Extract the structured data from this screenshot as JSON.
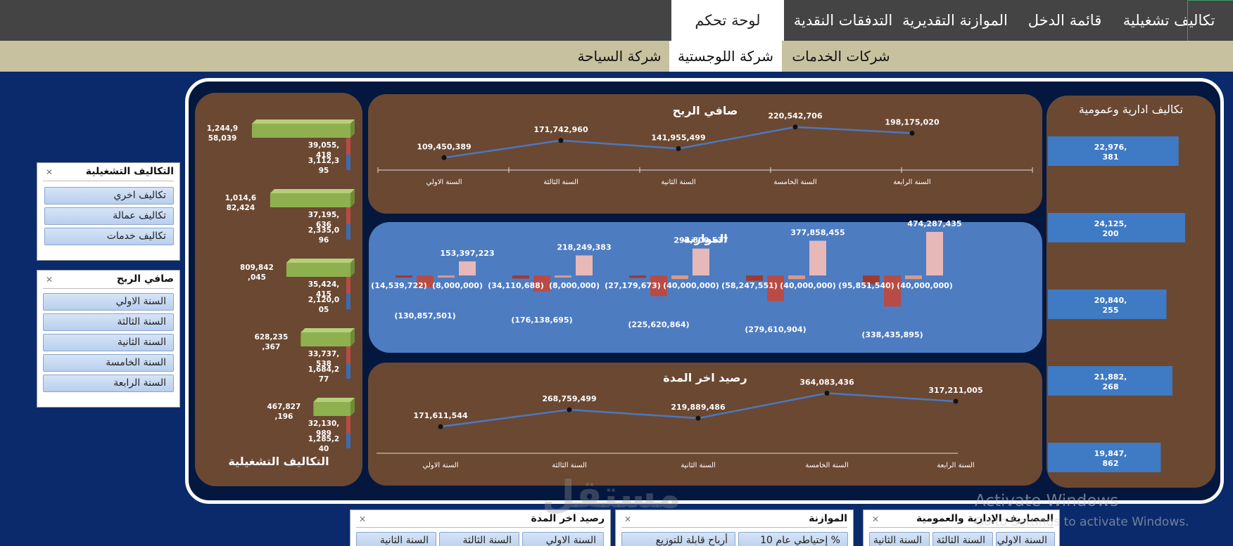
{
  "top_tabs": [
    {
      "label": "تكاليف تشغيلية"
    },
    {
      "label": "قائمة الدخل"
    },
    {
      "label": "الموازنة التقديرية"
    },
    {
      "label": "التدفقات النقدية"
    },
    {
      "label": "لوحة تحكم",
      "active": true
    }
  ],
  "sub_tabs": [
    {
      "label": "شركات الخدمات"
    },
    {
      "label": "شركة اللوجستية",
      "active": true
    },
    {
      "label": "شركة السياحة"
    }
  ],
  "slicers": {
    "operating_costs": {
      "title": "التكاليف التشغيلية",
      "items": [
        "تكاليف اخري",
        "تكاليف عمالة",
        "تكاليف خدمات"
      ]
    },
    "net_profit": {
      "title": "صافي الربح",
      "items": [
        "السنة الاولي",
        "السنة الثالثة",
        "السنة الثانية",
        "السنة الخامسة",
        "السنة الرابعة"
      ]
    },
    "end_balance": {
      "title": "رصيد اخر المدة",
      "items": [
        "السنة الاولي",
        "السنة الثالثة",
        "السنة الثانية"
      ]
    },
    "budget": {
      "title": "الموازنة",
      "items": [
        "إحتياطي عام 10 %",
        "أرباح قابلة للتوزيع"
      ]
    },
    "admin_expenses": {
      "title": "المصاريف الإدارية والعمومية",
      "items": [
        "السنة الاولي",
        "السنة الثالثة",
        "السنة الثانية"
      ]
    }
  },
  "watermark": {
    "line1": "Activate Windows",
    "line2": "Go to Settings to activate Windows.",
    "brand": "مستقل"
  },
  "chart_data": [
    {
      "id": "net_profit",
      "type": "line",
      "title": "صافي الربح",
      "categories": [
        "السنة الاولي",
        "السنة الثالثة",
        "السنة الثانية",
        "السنة الخامسة",
        "السنة الرابعة"
      ],
      "values": [
        109450389,
        171742960,
        141955499,
        220542706,
        198175020
      ],
      "labels": [
        "109,450,389",
        "171,742,960",
        "141,955,499",
        "220,542,706",
        "198,175,020"
      ],
      "color": "#4a78c0"
    },
    {
      "id": "budget",
      "type": "bar",
      "title": "الموازنة",
      "groups": [
        {
          "values": [
            -14539722,
            -130857501,
            -8000000,
            153397223
          ],
          "labels": [
            "(14,539,722)",
            "(130,857,501)",
            "(8,000,000)",
            "153,397,223"
          ]
        },
        {
          "values": [
            -34110688,
            -176138695,
            -8000000,
            218249383
          ],
          "labels": [
            "(34,110,688)",
            "(176,138,695)",
            "(8,000,000)",
            "218,249,383"
          ]
        },
        {
          "values": [
            -27179673,
            -225620864,
            -40000000,
            292800537
          ],
          "labels": [
            "(27,179,673)",
            "(225,620,864)",
            "(40,000,000)",
            "292,800,537"
          ]
        },
        {
          "values": [
            -58247551,
            -279610904,
            -40000000,
            377858455
          ],
          "labels": [
            "(58,247,551)",
            "(279,610,904)",
            "(40,000,000)",
            "377,858,455"
          ]
        },
        {
          "values": [
            -95851540,
            -338435895,
            -40000000,
            474287435
          ],
          "labels": [
            "(95,851,540)",
            "(338,435,895)",
            "(40,000,000)",
            "474,287,435"
          ]
        }
      ],
      "series_colors": [
        "#9e3a34",
        "#b84b45",
        "#d89a8a",
        "#e6b8b8"
      ]
    },
    {
      "id": "end_balance",
      "type": "line",
      "title": "رصيد اخر المدة",
      "categories": [
        "السنة الاولي",
        "السنة الثالثة",
        "السنة الثانية",
        "السنة الخامسة",
        "السنة الرابعة"
      ],
      "values": [
        171611544,
        268759499,
        219889486,
        364083436,
        317211005
      ],
      "labels": [
        "171,611,544",
        "268,759,499",
        "219,889,486",
        "364,083,436",
        "317,211,005"
      ],
      "color": "#4a78c0"
    },
    {
      "id": "operating_costs",
      "type": "bar",
      "title": "التكاليف التشغيلية",
      "groups": [
        {
          "values": [
            1244958039,
            39055418,
            3112395
          ],
          "labels": [
            "1,244,9\n58,039",
            "39,055,\n418",
            "3,112,3\n95"
          ]
        },
        {
          "values": [
            1014682424,
            37195636,
            2335096
          ],
          "labels": [
            "1,014,6\n82,424",
            "37,195,\n636",
            "2,335,0\n96"
          ]
        },
        {
          "values": [
            809842045,
            35424415,
            2120005
          ],
          "labels": [
            "809,842\n,045",
            "35,424,\n415",
            "2,120,0\n05"
          ]
        },
        {
          "values": [
            628235367,
            33737538,
            1684277
          ],
          "labels": [
            "628,235\n,367",
            "33,737,\n538",
            "1,684,2\n77"
          ]
        },
        {
          "values": [
            467827196,
            32130989,
            1285240
          ],
          "labels": [
            "467,827\n,196",
            "32,130,\n989",
            "1,285,2\n40"
          ]
        }
      ],
      "series_colors": [
        "#8fb04e",
        "#b84b45",
        "#3f6bb0"
      ]
    },
    {
      "id": "admin_expenses",
      "type": "bar",
      "title": "تكاليف ادارية وعمومية",
      "values": [
        22976381,
        24125200,
        20840255,
        21882268,
        19847862
      ],
      "labels": [
        "22,976,\n381",
        "24,125,\n200",
        "20,840,\n255",
        "21,882,\n268",
        "19,847,\n862"
      ],
      "color": "#3f7ac4"
    }
  ]
}
